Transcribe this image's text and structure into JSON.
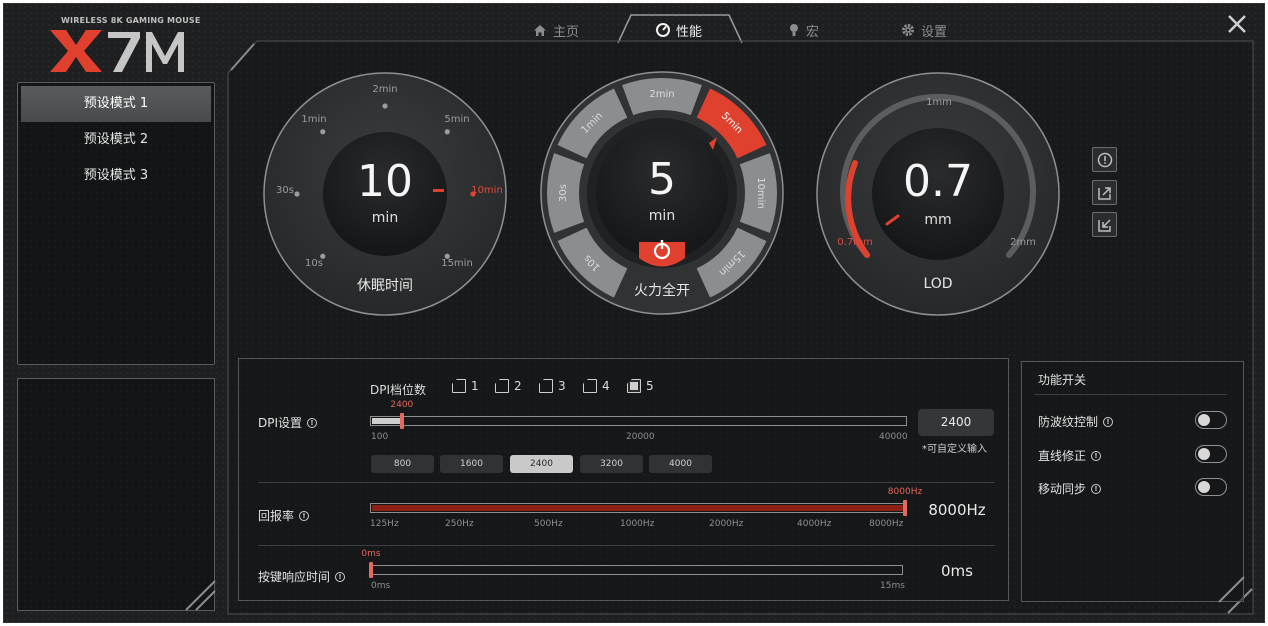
{
  "logo": {
    "subtitle": "WIRELESS 8K GAMING MOUSE",
    "brand": "X7M"
  },
  "tabs": [
    {
      "label": "主页",
      "icon": "home-icon",
      "active": false
    },
    {
      "label": "性能",
      "icon": "gauge-icon",
      "active": true
    },
    {
      "label": "宏",
      "icon": "macro-icon",
      "active": false
    },
    {
      "label": "设置",
      "icon": "gear-icon",
      "active": false
    }
  ],
  "modes": [
    {
      "label": "预设模式 1",
      "active": true
    },
    {
      "label": "预设模式 2",
      "active": false
    },
    {
      "label": "预设模式 3",
      "active": false
    }
  ],
  "sleep": {
    "value": "10",
    "unit": "min",
    "title": "休眠时间",
    "ticks": [
      "10s",
      "30s",
      "1min",
      "2min",
      "5min",
      "10min",
      "15min"
    ],
    "selected": "10min"
  },
  "fire": {
    "value": "5",
    "unit": "min",
    "title": "火力全开",
    "segments": [
      "10s",
      "30s",
      "1min",
      "2min",
      "5min",
      "10min",
      "15min"
    ],
    "selected": "5min"
  },
  "lod": {
    "value": "0.7",
    "unit": "mm",
    "title": "LOD",
    "ticks": [
      "0.7mm",
      "1mm",
      "2mm"
    ],
    "selected": "0.7mm",
    "level": 0.0
  },
  "dpi": {
    "label": "DPI设置",
    "stages_label": "DPI档位数",
    "stages": [
      "1",
      "2",
      "3",
      "4",
      "5"
    ],
    "active_stage": "5",
    "value": 2400,
    "min": 100,
    "max": 40000,
    "value_label": "2400",
    "scale": [
      "100",
      "20000",
      "40000"
    ],
    "input_value": "2400",
    "custom_note": "*可自定义输入",
    "presets": [
      "800",
      "1600",
      "2400",
      "3200",
      "4000"
    ],
    "active_preset": "2400"
  },
  "polling": {
    "label": "回报率",
    "value_label": "8000Hz",
    "display": "8000Hz",
    "scale": [
      "125Hz",
      "250Hz",
      "500Hz",
      "1000Hz",
      "2000Hz",
      "4000Hz",
      "8000Hz"
    ],
    "level": 1.0
  },
  "debounce": {
    "label": "按键响应时间",
    "value_label": "0ms",
    "display": "0ms",
    "scale": [
      "0ms",
      "15ms"
    ],
    "level": 0.0
  },
  "switches": {
    "title": "功能开关",
    "items": [
      {
        "label": "防波纹控制",
        "on": false
      },
      {
        "label": "直线修正",
        "on": false
      },
      {
        "label": "移动同步",
        "on": false
      }
    ]
  },
  "colors": {
    "accent": "#e0412f",
    "panel": "#1d1f21",
    "dial": "#2b2d2f"
  }
}
